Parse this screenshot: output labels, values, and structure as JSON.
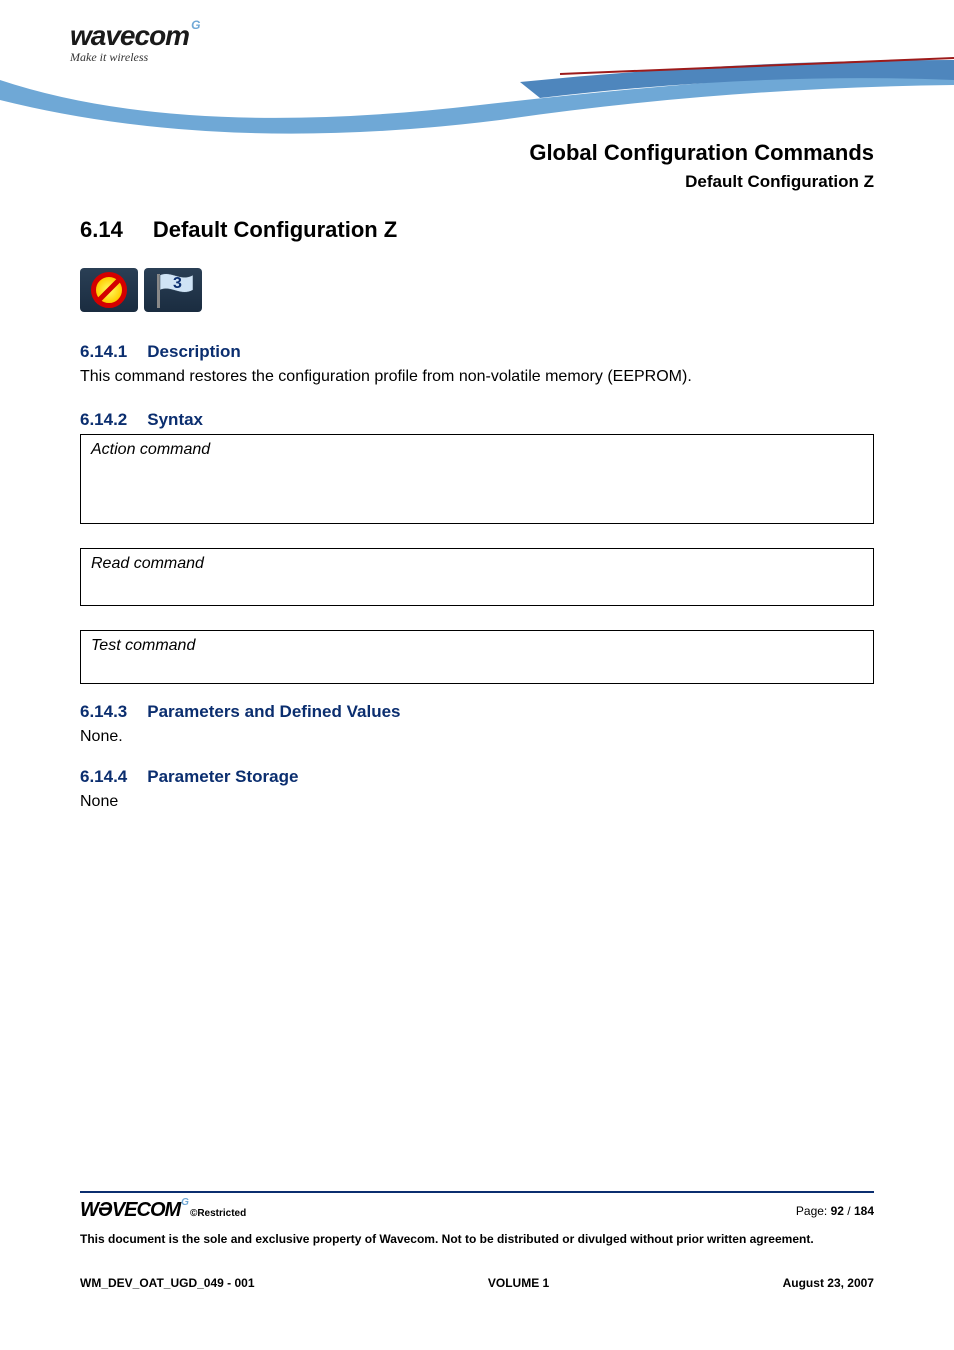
{
  "brand": {
    "logo_text": "wavecom",
    "logo_sup": "G",
    "tagline": "Make it wireless"
  },
  "doc_header": {
    "title": "Global Configuration Commands",
    "subtitle": "Default Configuration Z"
  },
  "section": {
    "number": "6.14",
    "title": "Default Configuration Z"
  },
  "icons": {
    "no_sim": "no-sim-required-icon",
    "flag_num": "3"
  },
  "subsections": {
    "desc": {
      "num": "6.14.1",
      "title": "Description",
      "text": "This command restores the configuration profile from non-volatile memory (EEPROM)."
    },
    "syntax": {
      "num": "6.14.2",
      "title": "Syntax",
      "action_label": "Action command",
      "read_label": "Read command",
      "test_label": "Test command"
    },
    "params": {
      "num": "6.14.3",
      "title": "Parameters and Defined Values",
      "text": "None."
    },
    "storage": {
      "num": "6.14.4",
      "title": "Parameter Storage",
      "text": "None"
    }
  },
  "footer": {
    "logo_text": "WƏVECOM",
    "logo_sup": "G",
    "restricted": "©Restricted",
    "page_label": "Page: ",
    "page_current": "92",
    "page_sep": " / ",
    "page_total": "184",
    "disclaimer": "This document is the sole and exclusive property of Wavecom. Not to be distributed or divulged without prior written agreement.",
    "doc_id": "WM_DEV_OAT_UGD_049 - 001",
    "volume": "VOLUME 1",
    "date": "August 23, 2007"
  }
}
